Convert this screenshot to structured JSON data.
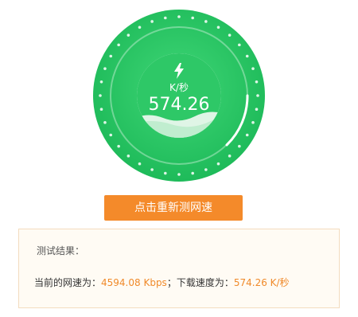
{
  "gauge": {
    "icon": "lightning-bolt-icon",
    "unit": "K/秒",
    "value": "574.26"
  },
  "retest_button": {
    "label": "点击重新测网速"
  },
  "result": {
    "heading": "测试结果：",
    "network_speed_label": "当前的网速为：",
    "network_speed_value": "4594.08 Kbps",
    "separator": "；",
    "download_speed_label": "下载速度为：",
    "download_speed_value": "574.26 K/秒"
  },
  "colors": {
    "gauge_green": "#22c55e",
    "button_orange": "#f48a2a",
    "value_orange": "#f08a2a"
  }
}
